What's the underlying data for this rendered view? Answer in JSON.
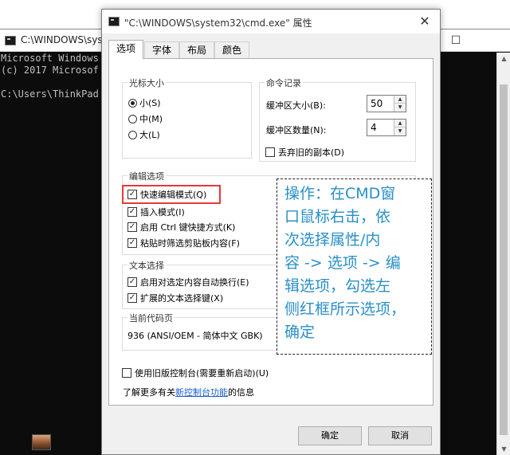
{
  "console": {
    "title": "C:\\WINDOWS\\syst",
    "lines": [
      "Microsoft Windows",
      "(c) 2017 Microsof",
      "",
      "C:\\Users\\ThinkPad"
    ],
    "controls": {
      "minimize": "—",
      "maximize": "☐"
    }
  },
  "dialog": {
    "title": "\"C:\\WINDOWS\\system32\\cmd.exe\" 属性",
    "close": "✕",
    "tabs": [
      "选项",
      "字体",
      "布局",
      "颜色"
    ],
    "cursor_size": {
      "title": "光标大小",
      "options": [
        "小(S)",
        "中(M)",
        "大(L)"
      ],
      "selected": "小(S)"
    },
    "command_history": {
      "title": "命令记录",
      "buffer_size_label": "缓冲区大小(B):",
      "buffer_size_value": "50",
      "buffer_count_label": "缓冲区数量(N):",
      "buffer_count_value": "4",
      "discard_duplicates_label": "丢弃旧的副本(D)",
      "discard_duplicates_checked": false
    },
    "edit_options": {
      "title": "编辑选项",
      "quick_edit": "快速编辑模式(Q)",
      "insert_mode": "插入模式(I)",
      "ctrl_shortcuts": "启用 Ctrl 键快捷方式(K)",
      "filter_paste": "粘贴时筛选剪贴板内容(F)"
    },
    "text_selection": {
      "title": "文本选择",
      "line_wrap": "启用对选定内容自动换行(E)",
      "extended_keys": "扩展的文本选择键(X)"
    },
    "codepage": {
      "title": "当前代码页",
      "value": "936   (ANSI/OEM - 简体中文 GBK)"
    },
    "legacy_console": "使用旧版控制台(需要重新启动)(U)",
    "learn_more_prefix": "了解更多有关",
    "learn_more_link": "新控制台功能",
    "learn_more_suffix": "的信息",
    "ok_label": "确定",
    "cancel_label": "取消"
  },
  "annotation": {
    "lines": [
      "操作：在CMD窗",
      "口鼠标右击，依",
      "次选择属性/内",
      "容 -> 选项 -> 编",
      "辑选项，勾选左",
      "侧红框所示选项，",
      "确定"
    ],
    "color": "#2a8fc9",
    "highlight_color": "#e53935"
  }
}
